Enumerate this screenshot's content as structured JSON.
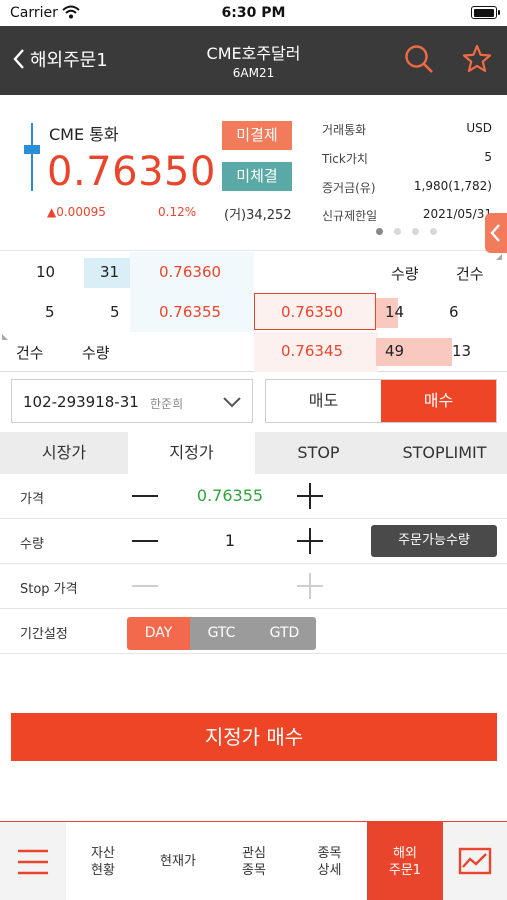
{
  "status_bar": {
    "carrier": "Carrier",
    "time": "6:30 PM",
    "battery_level": 1.0
  },
  "header": {
    "back_label": "해외주문1",
    "title": "CME호주달러",
    "subtitle": "6AM21"
  },
  "quote": {
    "name": "CME 통화",
    "price": "0.76350",
    "change": "▲0.00095",
    "change_pct": "0.12%",
    "unsettled_btn": "미결제",
    "unfilled_btn": "미체결",
    "volume": "(거)34,252",
    "info": [
      {
        "label": "거래통화",
        "value": "USD"
      },
      {
        "label": "Tick가치",
        "value": "5"
      },
      {
        "label": "증거금(유)",
        "value": "1,980(1,782)"
      },
      {
        "label": "신규제한일",
        "value": "2021/05/31"
      }
    ],
    "page_dots": 4,
    "active_dot": 0
  },
  "orderbook": {
    "ask_rows": [
      {
        "count": "10",
        "qty": "31",
        "price": "0.76360"
      },
      {
        "count": "5",
        "qty": "5",
        "price": "0.76355"
      }
    ],
    "header_qty": "수량",
    "header_count": "건수",
    "current_price": "0.76350",
    "bid_rows": [
      {
        "price": "0.76350",
        "qty": "14",
        "count": "6"
      },
      {
        "price": "0.76345",
        "qty": "49",
        "count": "13"
      }
    ],
    "footer_count": "건수",
    "footer_qty": "수량"
  },
  "account": {
    "number": "102-293918-31",
    "name": "한준희"
  },
  "side": {
    "sell": "매도",
    "buy": "매수",
    "selected": "buy"
  },
  "order_types": [
    "시장가",
    "지정가",
    "STOP",
    "STOPLIMIT"
  ],
  "order_type_selected": 1,
  "form": {
    "price_label": "가격",
    "price_value": "0.76355",
    "qty_label": "수량",
    "qty_value": "1",
    "avail_btn": "주문가능수량",
    "stop_label": "Stop 가격",
    "period_label": "기간설정",
    "periods": [
      "DAY",
      "GTC",
      "GTD"
    ],
    "period_selected": 0
  },
  "submit_label": "지정가 매수",
  "tabbar": {
    "items": [
      {
        "line1": "자산",
        "line2": "현황"
      },
      {
        "line1": "현재가",
        "line2": ""
      },
      {
        "line1": "관심",
        "line2": "종목"
      },
      {
        "line1": "종목",
        "line2": "상세"
      },
      {
        "line1": "해외",
        "line2": "주문1"
      }
    ],
    "active": 4
  },
  "colors": {
    "accent": "#ef4527",
    "header_bg": "#3a3a3a",
    "teal": "#5aa9a6",
    "green_price": "#2fa33a"
  },
  "icons": [
    "wifi-icon",
    "back-chevron-icon",
    "search-icon",
    "star-icon",
    "chevron-down-icon",
    "collapse-arrow-icon",
    "menu-icon",
    "chart-icon"
  ]
}
